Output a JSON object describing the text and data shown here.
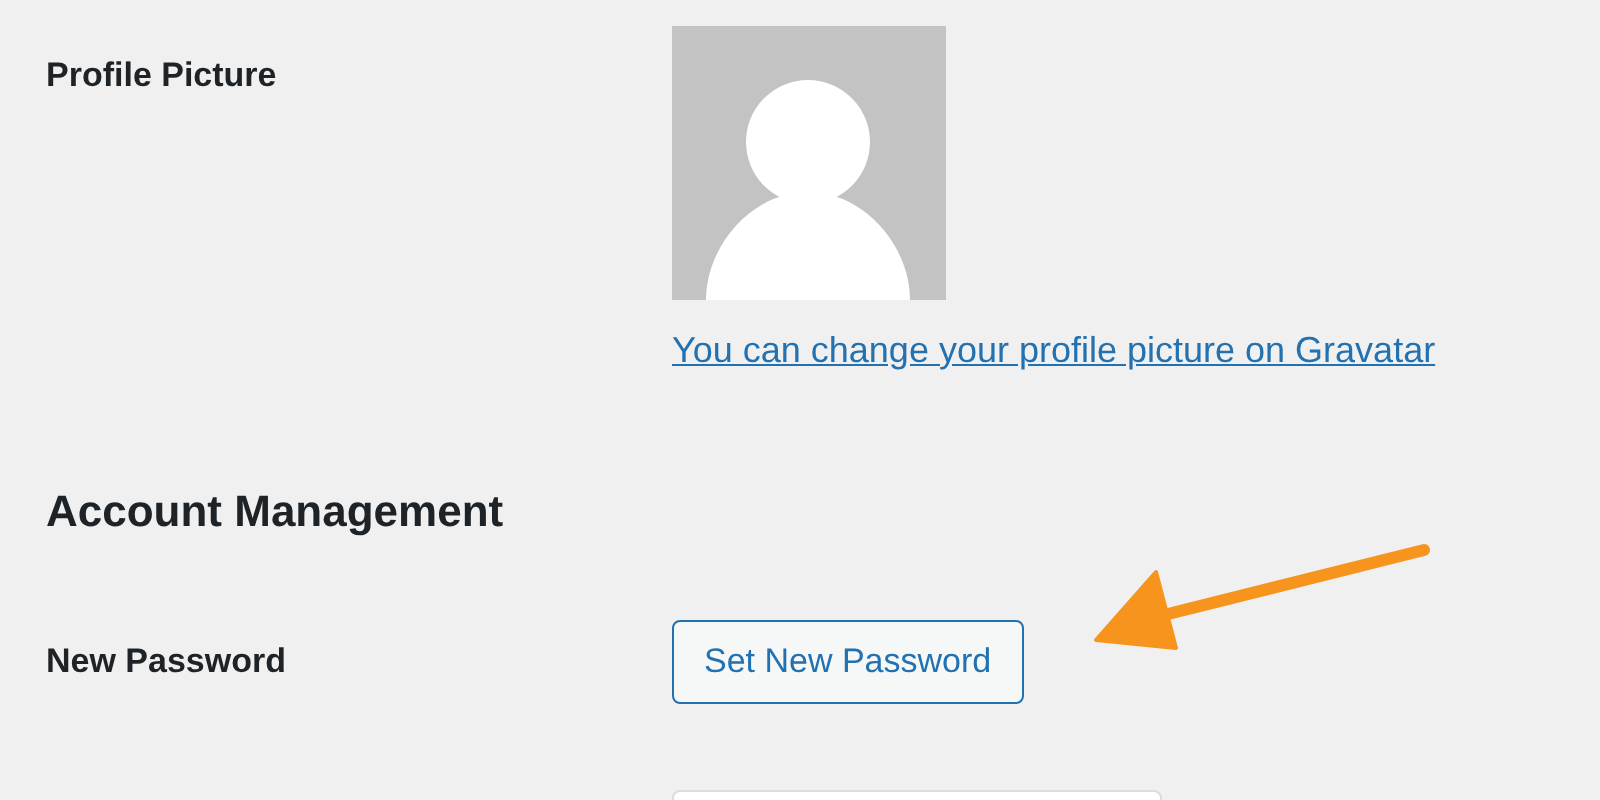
{
  "profile_picture": {
    "label": "Profile Picture",
    "link": "You can change your profile picture on Gravatar"
  },
  "account_management": {
    "heading": "Account Management",
    "new_password": {
      "label": "New Password",
      "button": "Set New Password"
    }
  }
}
